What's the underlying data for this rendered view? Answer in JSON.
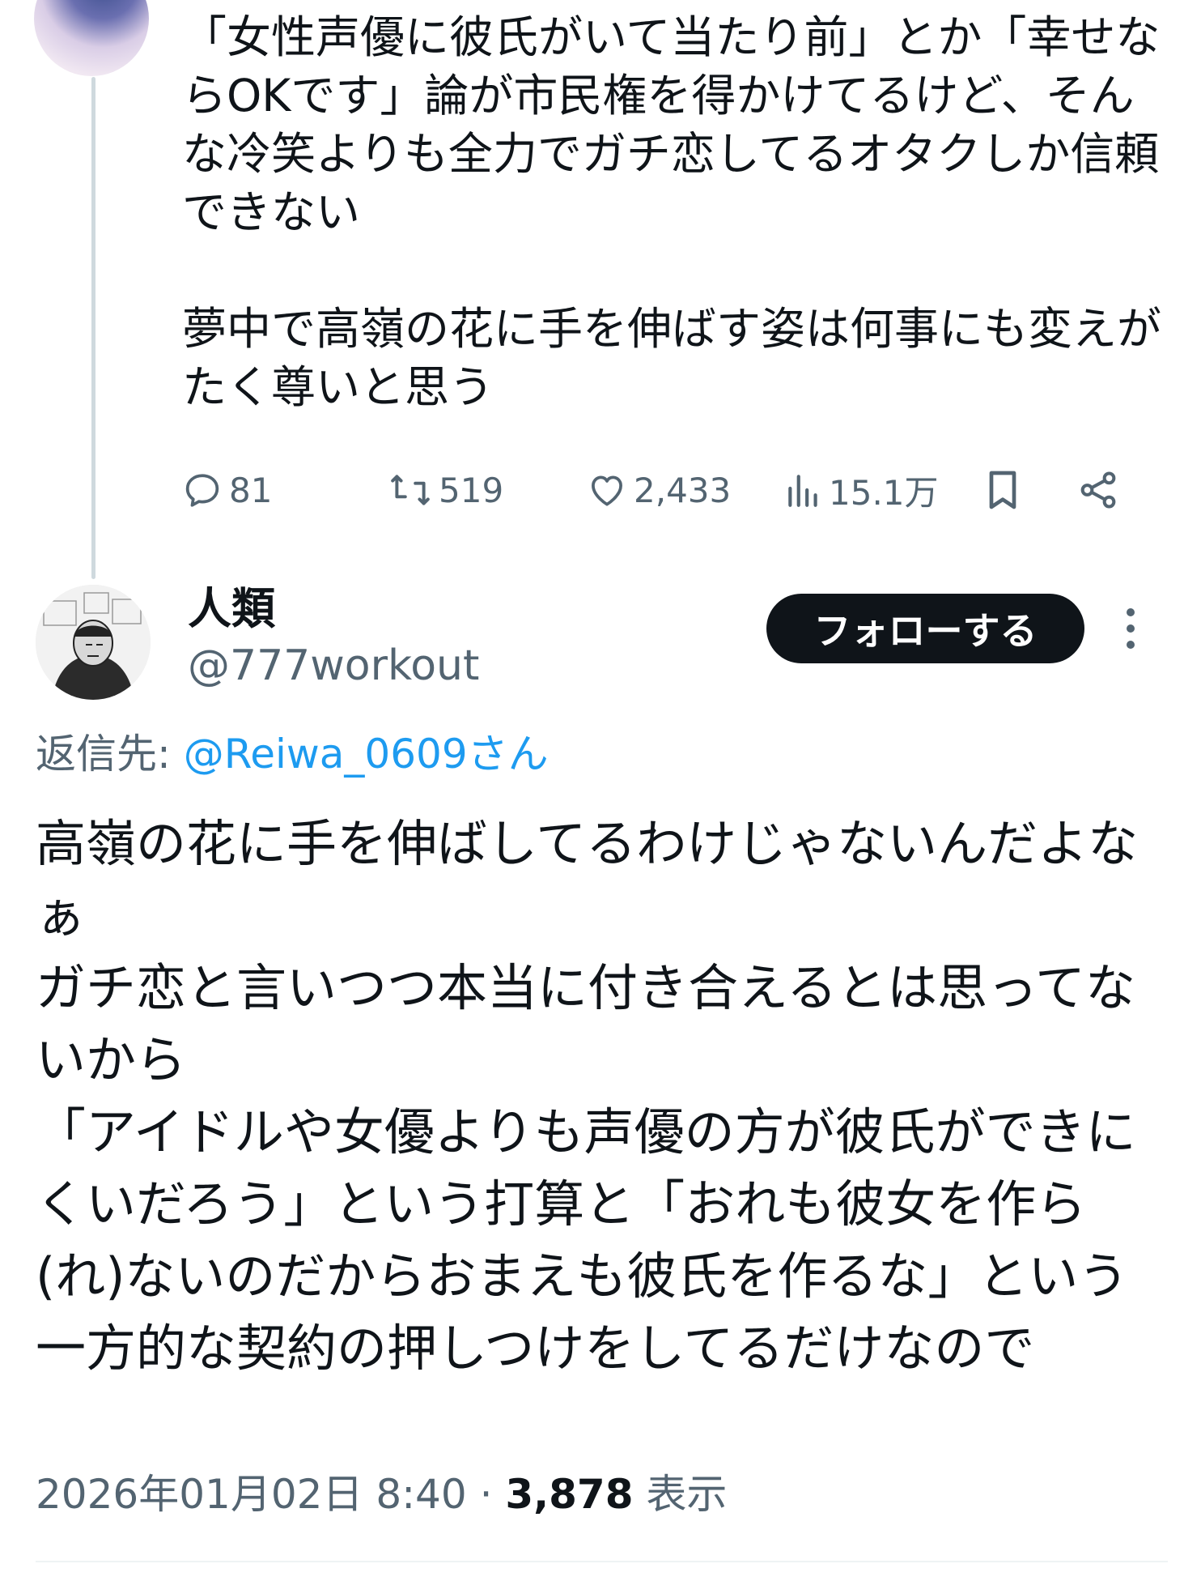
{
  "previous_tweet": {
    "text": "「女性声優に彼氏がいて当たり前」とか「幸せならOKです」論が市民権を得かけてるけど、そんな冷笑よりも全力でガチ恋してるオタクしか信頼できない\n\n夢中で高嶺の花に手を伸ばす姿は何事にも変えがたく尊いと思う",
    "replies": "81",
    "reposts": "519",
    "likes": "2,433",
    "views": "15.1万"
  },
  "tweet": {
    "display_name": "人類",
    "handle": "@777workout",
    "follow_label": "フォローする",
    "reply_prefix": "返信先: ",
    "reply_mention": "@Reiwa_0609さん",
    "text": "高嶺の花に手を伸ばしてるわけじゃないんだよなぁ\nガチ恋と言いつつ本当に付き合えるとは思ってないから\n「アイドルや女優よりも声優の方が彼氏ができにくいだろう」という打算と「おれも彼女を作ら(れ)ないのだからおまえも彼氏を作るな」という一方的な契約の押しつけをしてるだけなので",
    "timestamp": "2026年01月02日 8:40",
    "separator": " · ",
    "views_count": "3,878",
    "views_label": " 表示"
  },
  "icons": [
    "reply-icon",
    "repost-icon",
    "like-icon",
    "views-icon",
    "bookmark-icon",
    "share-icon",
    "more-icon"
  ],
  "colors": {
    "text": "#0f1419",
    "secondary": "#536471",
    "link": "#1d9bf0",
    "thread_line": "#cfd9de",
    "follow_button_bg": "#0f1419"
  }
}
